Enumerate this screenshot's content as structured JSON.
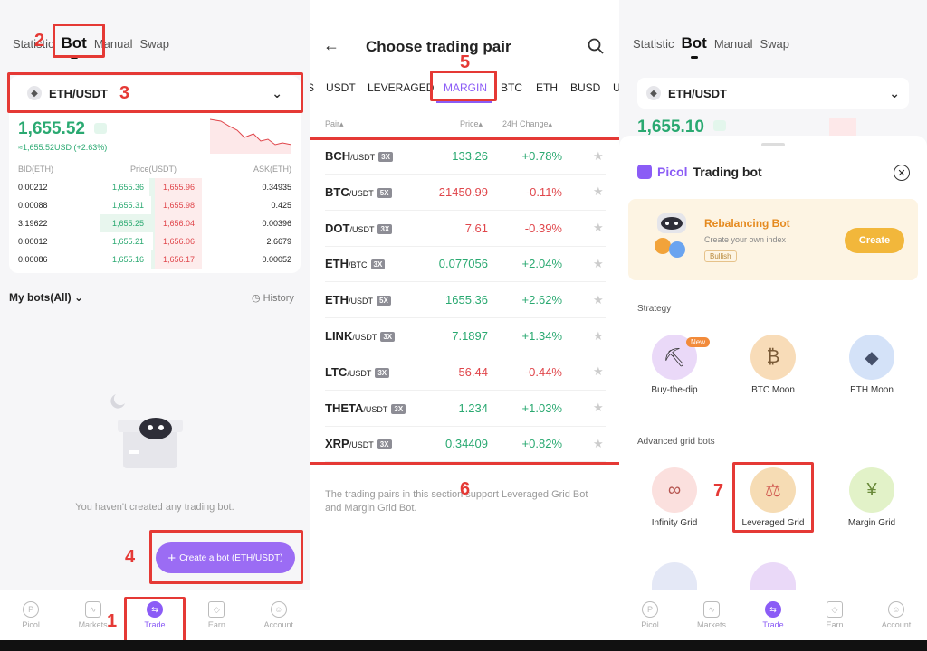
{
  "panel1": {
    "tabs": [
      "Statistic",
      "Bot",
      "Manual",
      "Swap"
    ],
    "pair": "ETH/USDT",
    "price": "1,655.52",
    "price_usd": "≈1,655.52USD (+2.63%)",
    "orderbook_headers": [
      "BID(ETH)",
      "Price(USDT)",
      "ASK(ETH)"
    ],
    "orderbook": [
      {
        "bid": "0.00212",
        "bid_price": "1,655.36",
        "ask_price": "1,655.96",
        "ask": "0.34935"
      },
      {
        "bid": "0.00088",
        "bid_price": "1,655.31",
        "ask_price": "1,655.98",
        "ask": "0.425"
      },
      {
        "bid": "3.19622",
        "bid_price": "1,655.25",
        "ask_price": "1,656.04",
        "ask": "0.00396"
      },
      {
        "bid": "0.00012",
        "bid_price": "1,655.21",
        "ask_price": "1,656.06",
        "ask": "2.6679"
      },
      {
        "bid": "0.00086",
        "bid_price": "1,655.16",
        "ask_price": "1,656.17",
        "ask": "0.00052"
      }
    ],
    "my_bots": "My bots(All)",
    "history": "History",
    "empty_text": "You haven't created any trading bot.",
    "create_button": "Create a bot (ETH/USDT)"
  },
  "nav": [
    "Picol",
    "Markets",
    "Trade",
    "Earn",
    "Account"
  ],
  "panel2": {
    "title": "Choose trading pair",
    "tabs": [
      "S",
      "USDT",
      "LEVERAGED",
      "MARGIN",
      "BTC",
      "ETH",
      "BUSD",
      "U"
    ],
    "col_pair": "Pair",
    "col_price": "Price",
    "col_change": "24H Change",
    "pairs": [
      {
        "base": "BCH",
        "quote": "/USDT",
        "lev": "3X",
        "price": "133.26",
        "change": "+0.78%",
        "up": true
      },
      {
        "base": "BTC",
        "quote": "/USDT",
        "lev": "5X",
        "price": "21450.99",
        "change": "-0.11%",
        "up": false
      },
      {
        "base": "DOT",
        "quote": "/USDT",
        "lev": "3X",
        "price": "7.61",
        "change": "-0.39%",
        "up": false
      },
      {
        "base": "ETH",
        "quote": "/BTC",
        "lev": "3X",
        "price": "0.077056",
        "change": "+2.04%",
        "up": true
      },
      {
        "base": "ETH",
        "quote": "/USDT",
        "lev": "5X",
        "price": "1655.36",
        "change": "+2.62%",
        "up": true
      },
      {
        "base": "LINK",
        "quote": "/USDT",
        "lev": "3X",
        "price": "7.1897",
        "change": "+1.34%",
        "up": true
      },
      {
        "base": "LTC",
        "quote": "/USDT",
        "lev": "3X",
        "price": "56.44",
        "change": "-0.44%",
        "up": false
      },
      {
        "base": "THETA",
        "quote": "/USDT",
        "lev": "3X",
        "price": "1.234",
        "change": "+1.03%",
        "up": true
      },
      {
        "base": "XRP",
        "quote": "/USDT",
        "lev": "3X",
        "price": "0.34409",
        "change": "+0.82%",
        "up": true
      }
    ],
    "note": "The trading pairs in this section support Leveraged Grid Bot and Margin Grid Bot."
  },
  "panel3": {
    "tabs": [
      "Statistic",
      "Bot",
      "Manual",
      "Swap"
    ],
    "pair": "ETH/USDT",
    "price": "1,655.10",
    "brand": "Picol",
    "sheet_title": "Trading bot",
    "banner_title": "Rebalancing Bot",
    "banner_sub": "Create your own index",
    "banner_tag": "Bullish",
    "banner_button": "Create",
    "strategy_label": "Strategy",
    "strategy": [
      "Buy-the-dip",
      "BTC Moon",
      "ETH Moon"
    ],
    "new_badge": "New",
    "advanced_label": "Advanced grid bots",
    "advanced": [
      "Infinity Grid",
      "Leveraged Grid",
      "Margin Grid"
    ]
  },
  "annotations": [
    "1",
    "2",
    "3",
    "4",
    "5",
    "6",
    "7"
  ],
  "colors": {
    "accent": "#8b5cf6",
    "green": "#2aa971",
    "red": "#e0464b",
    "annotation": "#e53935"
  }
}
